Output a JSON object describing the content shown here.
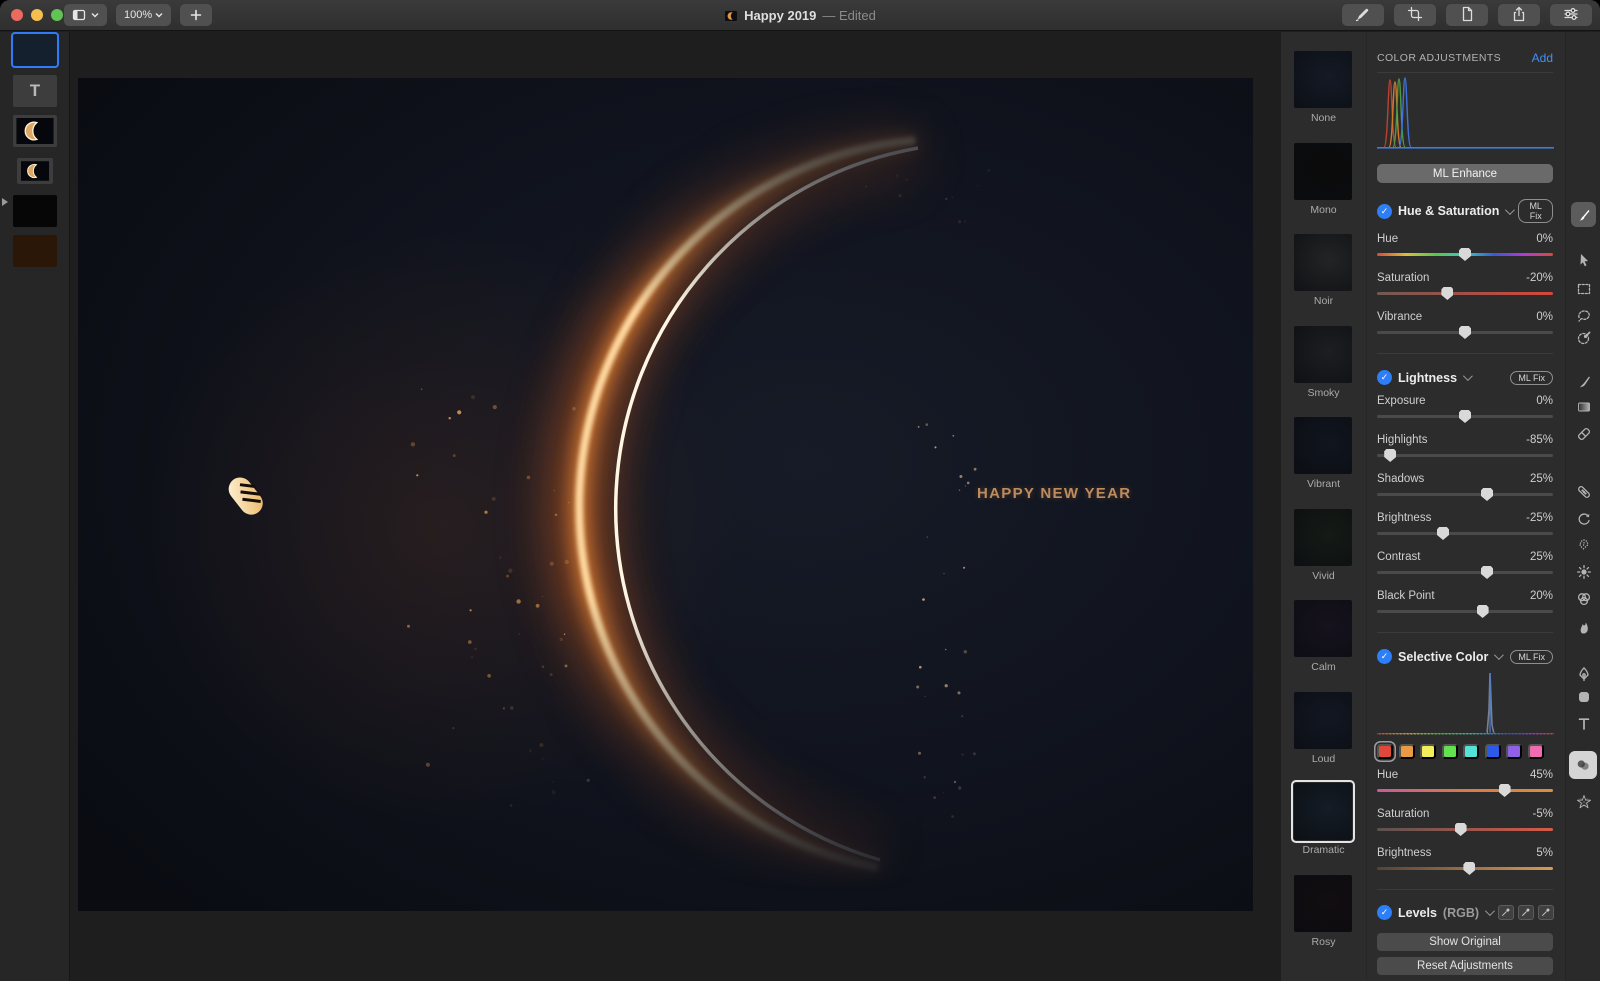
{
  "window": {
    "title": "Happy 2019",
    "edited_suffix": "— Edited",
    "zoom_level": "100%",
    "traffic_lights": [
      "#ed6a5e",
      "#f5bf4f",
      "#61c454"
    ]
  },
  "toolbar": {
    "left_buttons": [
      {
        "name": "view-options-button",
        "icon": "sidebar-icon"
      },
      {
        "name": "zoom-control",
        "icon": "chevron-down-icon"
      },
      {
        "name": "add-button",
        "icon": "plus-icon"
      }
    ],
    "right_buttons": [
      {
        "name": "annotate-button",
        "icon": "marker-icon"
      },
      {
        "name": "crop-button",
        "icon": "crop-icon"
      },
      {
        "name": "export-button",
        "icon": "document-icon"
      },
      {
        "name": "share-button",
        "icon": "share-icon"
      },
      {
        "name": "adjustments-button",
        "icon": "sliders-icon"
      }
    ]
  },
  "layers": {
    "items": [
      {
        "name": "composition-layer",
        "kind": "image",
        "selected": true,
        "color": "#15202e"
      },
      {
        "name": "text-layer",
        "kind": "text",
        "glyph": "T"
      },
      {
        "name": "crescent-layer",
        "kind": "image-crescent"
      },
      {
        "name": "crescent-sublayer",
        "kind": "image-crescent-small",
        "has_disclosure": true
      },
      {
        "name": "black-layer",
        "kind": "color",
        "color": "#060606"
      },
      {
        "name": "brown-layer",
        "kind": "color",
        "color": "#2a1708"
      }
    ]
  },
  "canvas": {
    "headline": "HAPPY NEW YEAR"
  },
  "presets": {
    "items": [
      {
        "label": "None",
        "color": "#141a26"
      },
      {
        "label": "Mono",
        "color": "#0b0b0b"
      },
      {
        "label": "Noir",
        "color": "#232425"
      },
      {
        "label": "Smoky",
        "color": "#1d1e21"
      },
      {
        "label": "Vibrant",
        "color": "#10151f"
      },
      {
        "label": "Vivid",
        "color": "#151a15"
      },
      {
        "label": "Calm",
        "color": "#16121e"
      },
      {
        "label": "Loud",
        "color": "#121723"
      },
      {
        "label": "Dramatic",
        "color": "#141c26",
        "selected": true
      },
      {
        "label": "Rosy",
        "color": "#120d10"
      }
    ]
  },
  "adjustments": {
    "header": "COLOR ADJUSTMENTS",
    "add_label": "Add",
    "ml_enhance_label": "ML Enhance",
    "ml_fix_label": "ML Fix",
    "accent_blue": "#2e7ef7",
    "sections": [
      {
        "id": "hue_saturation",
        "title": "Hue & Saturation",
        "checked": true,
        "ml_fix": true,
        "sliders": [
          {
            "label": "Hue",
            "display": "0%",
            "value": 0,
            "track": "hue"
          },
          {
            "label": "Saturation",
            "display": "-20%",
            "value": -20,
            "track": "sat"
          },
          {
            "label": "Vibrance",
            "display": "0%",
            "value": 0,
            "track": "plain"
          }
        ]
      },
      {
        "id": "lightness",
        "title": "Lightness",
        "checked": true,
        "ml_fix": true,
        "sliders": [
          {
            "label": "Exposure",
            "display": "0%",
            "value": 0,
            "track": "plain"
          },
          {
            "label": "Highlights",
            "display": "-85%",
            "value": -85,
            "track": "plain"
          },
          {
            "label": "Shadows",
            "display": "25%",
            "value": 25,
            "track": "plain"
          },
          {
            "label": "Brightness",
            "display": "-25%",
            "value": -25,
            "track": "plain"
          },
          {
            "label": "Contrast",
            "display": "25%",
            "value": 25,
            "track": "plain"
          },
          {
            "label": "Black Point",
            "display": "20%",
            "value": 20,
            "track": "plain"
          }
        ]
      },
      {
        "id": "selective_color",
        "title": "Selective Color",
        "checked": true,
        "ml_fix": true,
        "has_histogram": true,
        "swatches": [
          {
            "name": "red-swatch",
            "color": "#e0493a",
            "selected": true
          },
          {
            "name": "orange-swatch",
            "color": "#e89a45"
          },
          {
            "name": "yellow-swatch",
            "color": "#f2f058"
          },
          {
            "name": "green-swatch",
            "color": "#62e24e"
          },
          {
            "name": "cyan-swatch",
            "color": "#52e2d8"
          },
          {
            "name": "blue-swatch",
            "color": "#2b59e8"
          },
          {
            "name": "purple-swatch",
            "color": "#9061e8"
          },
          {
            "name": "pink-swatch",
            "color": "#ef6bb0"
          }
        ],
        "sliders": [
          {
            "label": "Hue",
            "display": "45%",
            "value": 45,
            "track": "schue"
          },
          {
            "label": "Saturation",
            "display": "-5%",
            "value": -5,
            "track": "scsat"
          },
          {
            "label": "Brightness",
            "display": "5%",
            "value": 5,
            "track": "scbright"
          }
        ]
      }
    ],
    "levels": {
      "title": "Levels",
      "mode": "(RGB)",
      "checked": true,
      "eyedroppers": [
        "black-point-eyedropper-button",
        "midtone-eyedropper-button",
        "white-point-eyedropper-button"
      ]
    },
    "show_original_label": "Show Original",
    "reset_label": "Reset Adjustments"
  },
  "tool_strip": [
    {
      "name": "style-brush-tool",
      "state": "active-soft"
    },
    {
      "name": "arrange-tool"
    },
    {
      "name": "rect-selection-tool"
    },
    {
      "name": "lasso-selection-tool"
    },
    {
      "name": "quick-selection-tool"
    },
    {
      "name": "paint-tool"
    },
    {
      "name": "gradient-tool"
    },
    {
      "name": "eraser-tool"
    },
    {
      "name": "repair-tool"
    },
    {
      "name": "clone-tool"
    },
    {
      "name": "texture-tool"
    },
    {
      "name": "light-tool"
    },
    {
      "name": "color-balance-tool"
    },
    {
      "name": "warp-tool"
    },
    {
      "name": "pen-tool"
    },
    {
      "name": "shape-tool"
    },
    {
      "name": "type-tool"
    },
    {
      "name": "color-adjustments-tool",
      "state": "active"
    },
    {
      "name": "effects-tool"
    }
  ]
}
